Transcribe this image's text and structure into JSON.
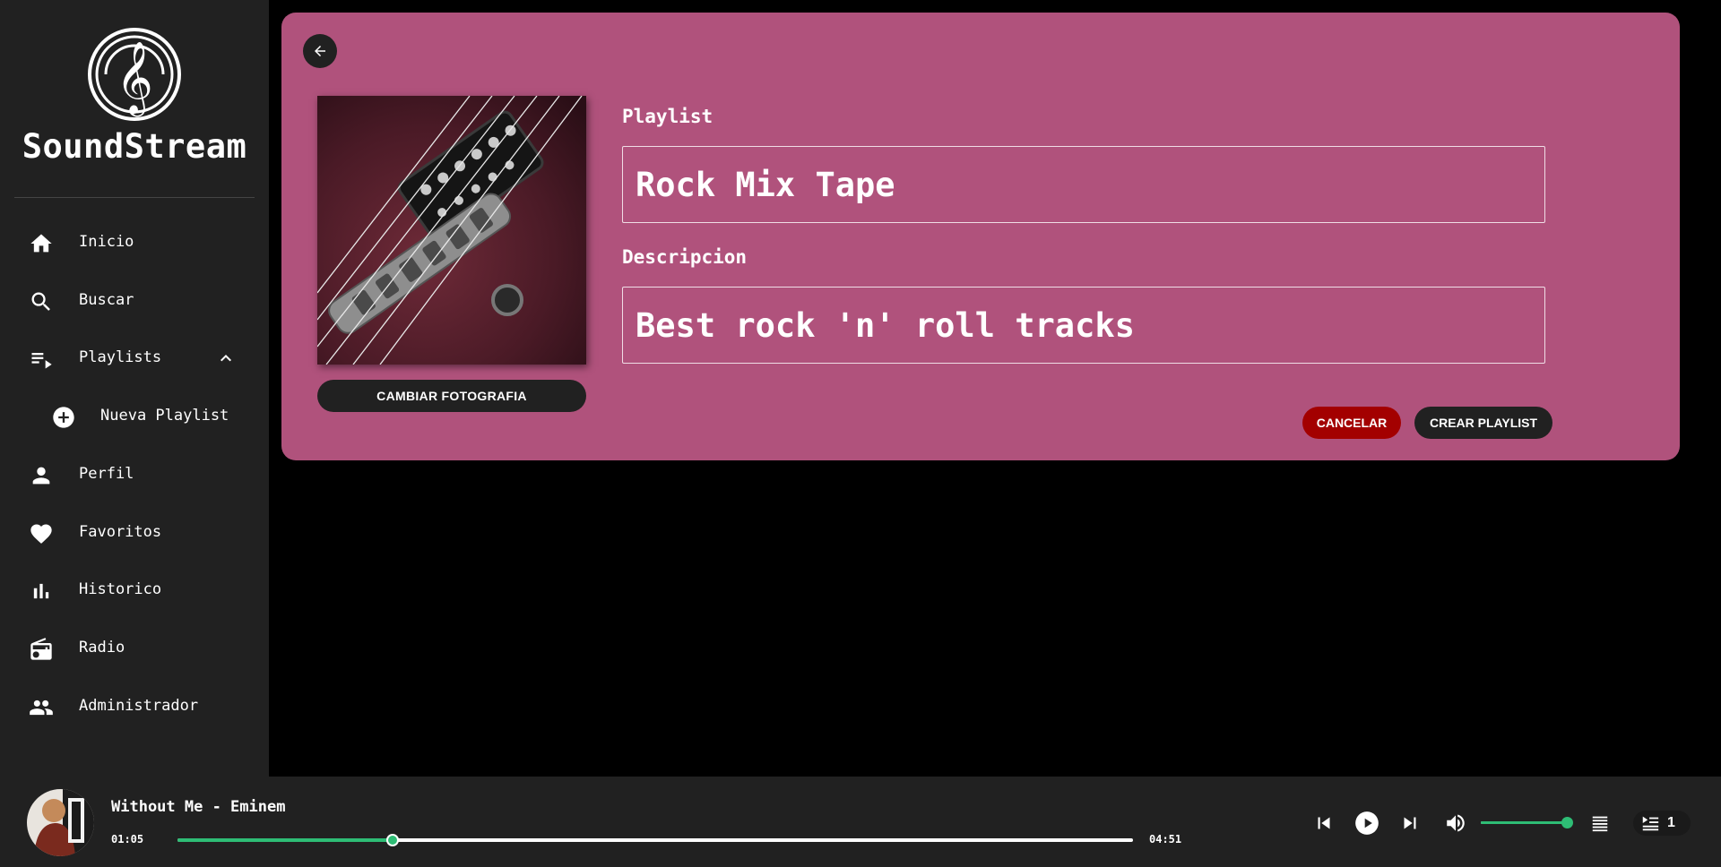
{
  "app": {
    "name": "SoundStream"
  },
  "sidebar": {
    "items": [
      {
        "label": "Inicio",
        "icon": "home-icon"
      },
      {
        "label": "Buscar",
        "icon": "search-icon"
      },
      {
        "label": "Playlists",
        "icon": "playlist-icon",
        "expanded": true
      },
      {
        "label": "Nueva Playlist",
        "icon": "add-circle-icon"
      },
      {
        "label": "Perfil",
        "icon": "person-icon"
      },
      {
        "label": "Favoritos",
        "icon": "heart-icon"
      },
      {
        "label": "Historico",
        "icon": "bar-chart-icon"
      },
      {
        "label": "Radio",
        "icon": "radio-icon"
      },
      {
        "label": "Administrador",
        "icon": "people-icon"
      }
    ]
  },
  "form": {
    "change_photo": "CAMBIAR FOTOGRAFIA",
    "playlist_label": "Playlist",
    "playlist_value": "Rock Mix Tape",
    "description_label": "Descripcion",
    "description_value": "Best rock 'n' roll tracks",
    "cancel": "CANCELAR",
    "create": "CREAR PLAYLIST"
  },
  "player": {
    "track": "Without Me - Eminem",
    "current_time": "01:05",
    "duration": "04:51",
    "progress_fraction": 0.225,
    "volume_fraction": 1.0,
    "queue_count": "1"
  },
  "colors": {
    "accent": "#2ebd75",
    "card": "#b0527c",
    "cancel": "#a30000",
    "panel": "#212121"
  }
}
